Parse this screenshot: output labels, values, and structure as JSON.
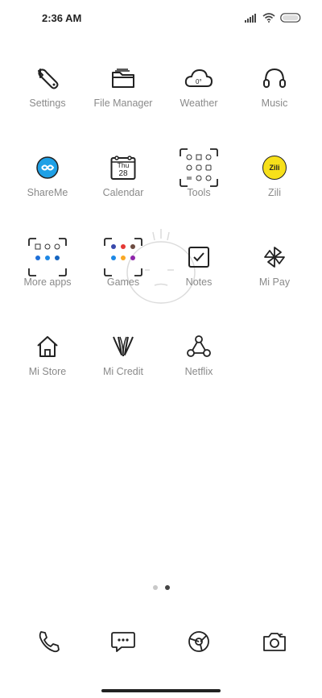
{
  "status": {
    "time": "2:36 AM"
  },
  "apps": [
    {
      "label": "Settings"
    },
    {
      "label": "File Manager"
    },
    {
      "label": "Weather"
    },
    {
      "label": "Music"
    },
    {
      "label": "ShareMe"
    },
    {
      "label": "Calendar",
      "day": "Thu",
      "date": "28"
    },
    {
      "label": "Tools"
    },
    {
      "label": "Zili",
      "badge": "Zili"
    },
    {
      "label": "More apps"
    },
    {
      "label": "Games"
    },
    {
      "label": "Notes"
    },
    {
      "label": "Mi Pay"
    },
    {
      "label": "Mi Store"
    },
    {
      "label": "Mi Credit"
    },
    {
      "label": "Netflix"
    }
  ],
  "dock": [
    {
      "icon": "phone-icon"
    },
    {
      "icon": "messages-icon"
    },
    {
      "icon": "browser-icon"
    },
    {
      "icon": "camera-icon"
    }
  ],
  "pager": {
    "pages": 2,
    "active": 2
  },
  "colors": {
    "shareme": "#1ea0e6",
    "zili": "#f7e01a",
    "label": "#8a8a8a"
  }
}
